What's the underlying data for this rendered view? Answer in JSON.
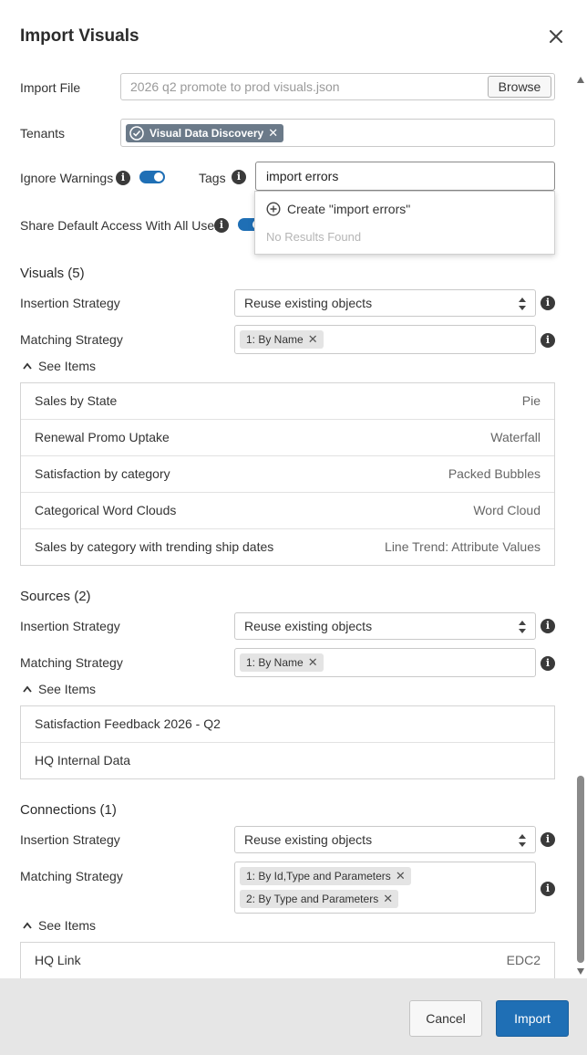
{
  "dialog": {
    "title": "Import Visuals"
  },
  "import_file": {
    "label": "Import File",
    "value": "2026 q2 promote to prod visuals.json",
    "browse_label": "Browse"
  },
  "tenants": {
    "label": "Tenants",
    "chips": [
      "Visual Data Discovery"
    ]
  },
  "ignore_warnings": {
    "label": "Ignore Warnings",
    "enabled": true
  },
  "tags": {
    "label": "Tags",
    "value": "import errors",
    "create_label": "Create \"import errors\"",
    "no_results": "No Results Found"
  },
  "share_access": {
    "label": "Share Default Access With All Users",
    "enabled": true
  },
  "visuals": {
    "title": "Visuals (5)",
    "insertion_label": "Insertion Strategy",
    "insertion_value": "Reuse existing objects",
    "matching_label": "Matching Strategy",
    "matching_tags": [
      "1: By Name"
    ],
    "see_items": "See Items",
    "items": [
      {
        "name": "Sales by State",
        "type": "Pie"
      },
      {
        "name": "Renewal Promo Uptake",
        "type": "Waterfall"
      },
      {
        "name": "Satisfaction by category",
        "type": "Packed Bubbles"
      },
      {
        "name": "Categorical Word Clouds",
        "type": "Word Cloud"
      },
      {
        "name": "Sales by category with trending ship dates",
        "type": "Line Trend: Attribute Values"
      }
    ]
  },
  "sources": {
    "title": "Sources (2)",
    "insertion_label": "Insertion Strategy",
    "insertion_value": "Reuse existing objects",
    "matching_label": "Matching Strategy",
    "matching_tags": [
      "1: By Name"
    ],
    "see_items": "See Items",
    "items": [
      {
        "name": "Satisfaction Feedback 2026 - Q2",
        "type": ""
      },
      {
        "name": "HQ Internal Data",
        "type": ""
      }
    ]
  },
  "connections": {
    "title": "Connections (1)",
    "insertion_label": "Insertion Strategy",
    "insertion_value": "Reuse existing objects",
    "matching_label": "Matching Strategy",
    "matching_tags": [
      "1: By Id,Type and Parameters",
      "2: By Type and Parameters"
    ],
    "see_items": "See Items",
    "items": [
      {
        "name": "HQ Link",
        "type": "EDC2"
      }
    ]
  },
  "footer": {
    "cancel_label": "Cancel",
    "import_label": "Import"
  },
  "colors": {
    "primary": "#1f6fb5",
    "chip": "#6b7a89",
    "footer_bg": "#e6e6e6"
  }
}
